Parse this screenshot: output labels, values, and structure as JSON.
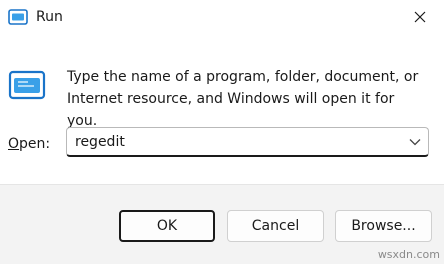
{
  "window": {
    "title": "Run",
    "close_glyph": "✕"
  },
  "dialog": {
    "description_line1": "Type the name of a program, folder, document, or",
    "description_line2": "Internet resource, and Windows will open it for you.",
    "open_label_accel": "O",
    "open_label_rest": "pen:",
    "input_value": "regedit"
  },
  "buttons": {
    "ok": "OK",
    "cancel": "Cancel",
    "browse": "Browse..."
  },
  "watermark": "wsxdn.com",
  "icons": {
    "title": "run-app-icon",
    "main": "run-app-icon",
    "dropdown": "chevron-down-icon",
    "close": "close-icon"
  },
  "colors": {
    "accent": "#1a74c9",
    "footer_bg": "#f3f3f3"
  }
}
